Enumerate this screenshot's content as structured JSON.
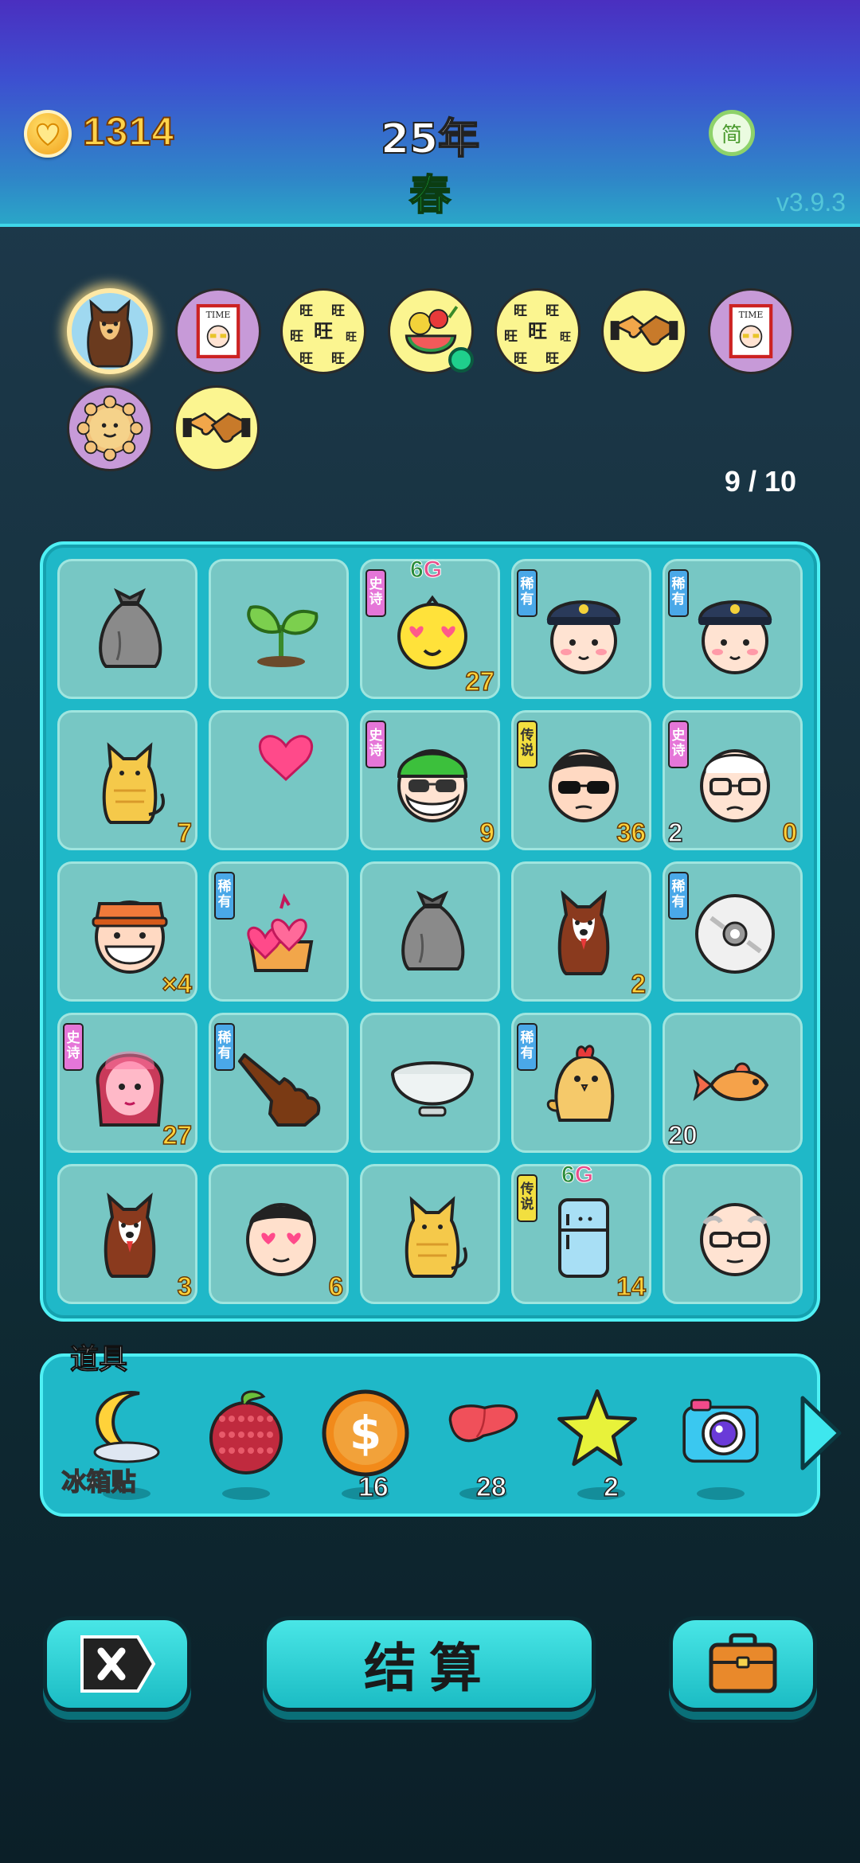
{
  "header": {
    "coin_value": "1314",
    "year": "25年",
    "season": "春",
    "simplified_label": "简",
    "version": "v3.9.3"
  },
  "avatars": [
    {
      "name": "shiba-dog",
      "bg": "blue",
      "selected": true
    },
    {
      "name": "time-magazine",
      "bg": "purple"
    },
    {
      "name": "wang-pattern",
      "bg": "yellow"
    },
    {
      "name": "fruit-bowl",
      "bg": "yellow",
      "online": true
    },
    {
      "name": "wang-pattern",
      "bg": "yellow"
    },
    {
      "name": "handshake",
      "bg": "yellow"
    },
    {
      "name": "time-magazine",
      "bg": "purple"
    },
    {
      "name": "sun-cookie",
      "bg": "purple"
    },
    {
      "name": "handshake",
      "bg": "yellow"
    }
  ],
  "slot_count": "9 / 10",
  "rarity_labels": {
    "rare": "稀有",
    "epic": "史诗",
    "legend": "传说"
  },
  "board": [
    {
      "icon": "garbage-bag-icon"
    },
    {
      "icon": "sprout-icon"
    },
    {
      "icon": "heart-eyes-chick-icon",
      "rarity": "epic",
      "tag": "6G",
      "br": "27"
    },
    {
      "icon": "police-officer-icon",
      "rarity": "rare"
    },
    {
      "icon": "police-officer-icon",
      "rarity": "rare"
    },
    {
      "icon": "yellow-cat-icon",
      "br": "7"
    },
    {
      "icon": "flying-heart-icon"
    },
    {
      "icon": "green-hair-grandpa-icon",
      "rarity": "epic",
      "br": "9"
    },
    {
      "icon": "sunglasses-boss-icon",
      "rarity": "legend",
      "br": "36"
    },
    {
      "icon": "old-professor-icon",
      "rarity": "epic",
      "bl": "2",
      "br": "0"
    },
    {
      "icon": "mask-worker-icon",
      "br": "×4"
    },
    {
      "icon": "heart-cake-icon",
      "rarity": "rare"
    },
    {
      "icon": "garbage-bag-icon"
    },
    {
      "icon": "husky-dog-icon",
      "br": "2"
    },
    {
      "icon": "cd-disc-icon",
      "rarity": "rare"
    },
    {
      "icon": "pink-hair-girl-icon",
      "rarity": "epic",
      "br": "27"
    },
    {
      "icon": "pointing-hand-icon",
      "rarity": "rare"
    },
    {
      "icon": "empty-bowl-icon"
    },
    {
      "icon": "chicken-icon",
      "rarity": "rare"
    },
    {
      "icon": "goldfish-icon",
      "bl": "20"
    },
    {
      "icon": "husky-dog-icon",
      "br": "3"
    },
    {
      "icon": "heart-eyes-man-icon",
      "br": "6"
    },
    {
      "icon": "yellow-cat-icon"
    },
    {
      "icon": "blue-fridge-icon",
      "rarity": "legend",
      "tag": "6G",
      "br": "14"
    },
    {
      "icon": "bald-grandpa-icon"
    }
  ],
  "tools": {
    "title": "道具",
    "items": [
      {
        "icon": "moon-fridge-magnet-icon",
        "label": "冰箱贴"
      },
      {
        "icon": "bayberry-icon"
      },
      {
        "icon": "coin-icon",
        "count": "16"
      },
      {
        "icon": "liver-icon",
        "count": "28"
      },
      {
        "icon": "star-icon",
        "count": "2"
      },
      {
        "icon": "camera-icon"
      }
    ]
  },
  "buttons": {
    "settle": "结算"
  },
  "colors": {
    "header_top": "#4a2fc0",
    "board": "#1fb8c8",
    "cell": "#77c7c4",
    "coin_text": "#ffd34a",
    "season_text": "#25e04c"
  }
}
